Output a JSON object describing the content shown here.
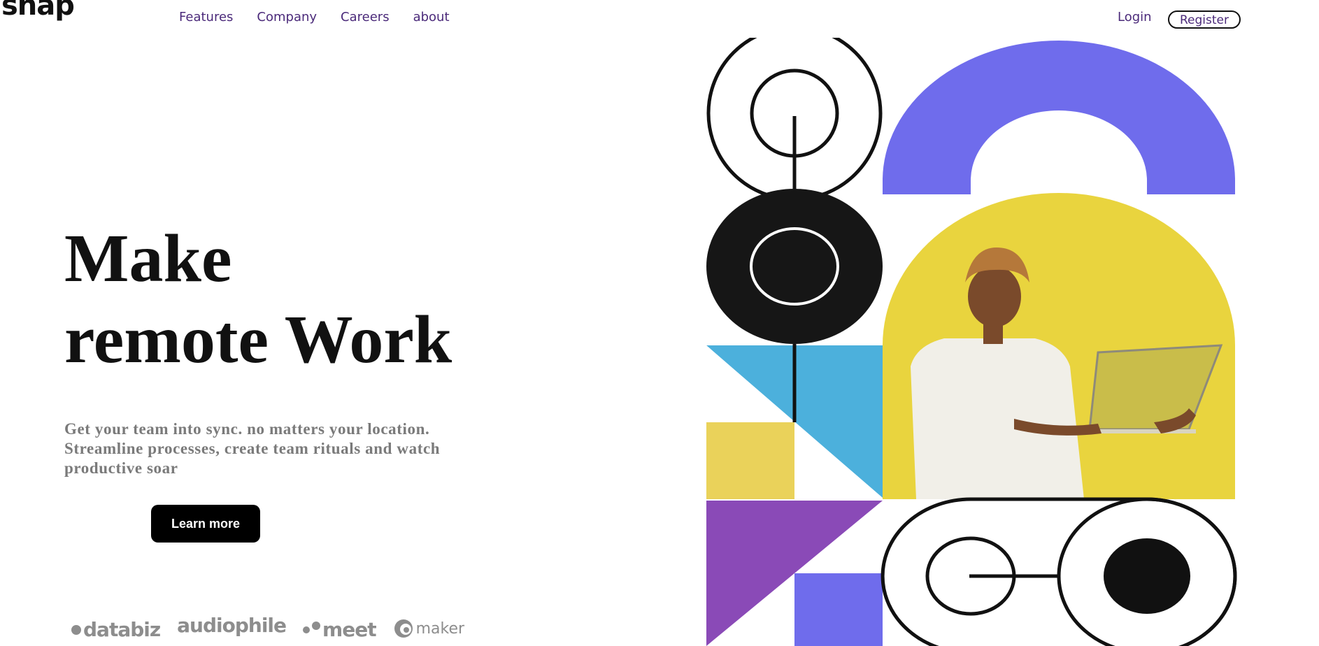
{
  "header": {
    "logo": "snap",
    "nav": [
      "Features",
      "Company",
      "Careers",
      "about"
    ],
    "login_label": "Login",
    "register_label": "Register"
  },
  "hero": {
    "title_line1": "Make",
    "title_line2": "remote Work",
    "subtitle": "Get your team into sync. no matters your location. Streamline processes, create team rituals and watch productive soar",
    "cta_label": "Learn more"
  },
  "clients": [
    "databiz",
    "audiophile",
    "meet",
    "maker"
  ],
  "colors": {
    "nav_text": "#4b2a7a",
    "accent_purple": "#6f6cec",
    "yellow": "#e9d43e",
    "blue": "#4cb0dc",
    "violet": "#8a4ab7"
  },
  "icons": [
    "databiz-logo-icon",
    "audiophile-logo-icon",
    "meet-logo-icon",
    "maker-logo-icon"
  ]
}
